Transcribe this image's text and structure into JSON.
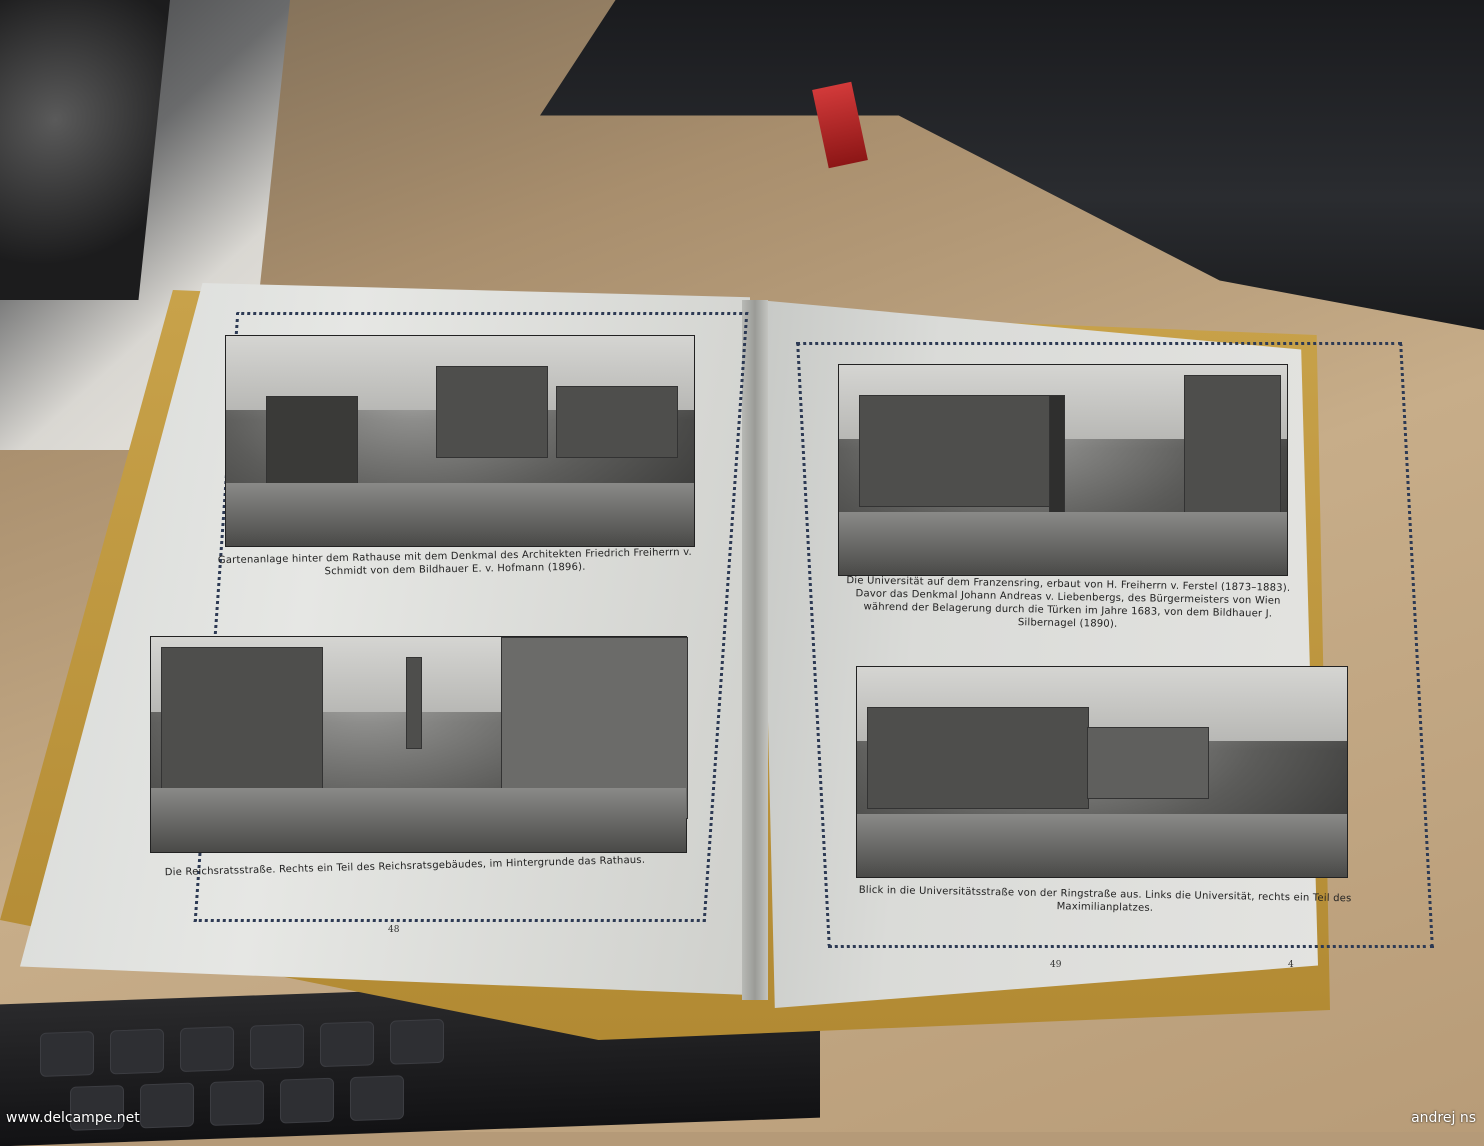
{
  "left_page": {
    "caption_top": "Gartenanlage hinter dem Rathause mit dem Denkmal des Architekten Friedrich Freiherrn v. Schmidt von dem Bildhauer E. v. Hofmann (1896).",
    "caption_bottom": "Die Reichsratsstraße. Rechts ein Teil des Reichsratsgebäudes, im Hintergrunde das Rathaus.",
    "page_number": "48"
  },
  "right_page": {
    "caption_top": "Die Universität auf dem Franzensring, erbaut von H. Freiherrn v. Ferstel (1873–1883). Davor das Denkmal Johann Andreas v. Liebenbergs, des Bürgermeisters von Wien während der Belagerung durch die Türken im Jahre 1683, von dem Bildhauer J. Silbernagel (1890).",
    "caption_bottom": "Blick in die Universitätsstraße von der Ringstraße aus. Links die Universität, rechts ein Teil des Maximilianplatzes.",
    "page_number": "49",
    "signature_mark": "4"
  },
  "watermark": {
    "left": "www.delcampe.net",
    "right": "andrej ns"
  }
}
